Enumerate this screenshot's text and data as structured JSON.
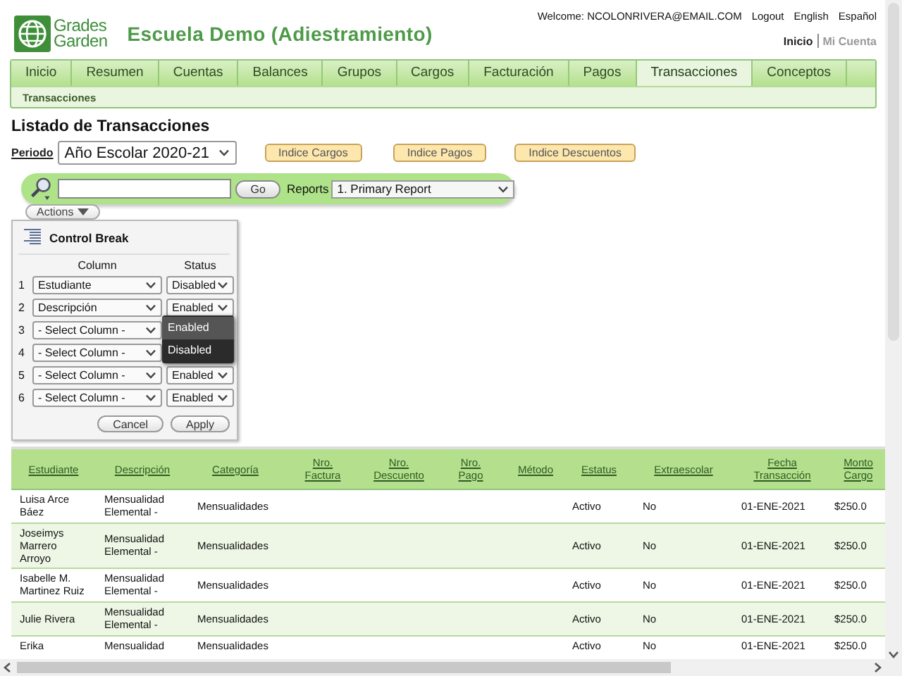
{
  "header": {
    "logo_words": [
      "Grades",
      "Garden"
    ],
    "school_title": "Escuela Demo (Adiestramiento)",
    "welcome": "Welcome: NCOLONRIVERA@EMAIL.COM",
    "user_links": [
      "Logout",
      "English",
      "Español"
    ],
    "account_links": [
      {
        "label": "Inicio",
        "selected": true
      },
      {
        "label": "Mi Cuenta",
        "selected": false
      }
    ]
  },
  "nav": {
    "tabs": [
      {
        "label": "Inicio",
        "selected": false
      },
      {
        "label": "Resumen",
        "selected": false
      },
      {
        "label": "Cuentas",
        "selected": false
      },
      {
        "label": "Balances",
        "selected": false
      },
      {
        "label": "Grupos",
        "selected": false
      },
      {
        "label": "Cargos",
        "selected": false
      },
      {
        "label": "Facturación",
        "selected": false
      },
      {
        "label": "Pagos",
        "selected": false
      },
      {
        "label": "Transacciones",
        "selected": true
      },
      {
        "label": "Conceptos",
        "selected": false
      }
    ],
    "subtabs": [
      "Transacciones"
    ]
  },
  "page_title": "Listado de Transacciones",
  "period": {
    "label": "Periodo",
    "value": "Año Escolar 2020-21"
  },
  "index_buttons": [
    "Indice Cargos",
    "Indice Pagos",
    "Indice Descuentos"
  ],
  "search": {
    "go_button": "Go",
    "reports_label": "Reports",
    "report": "1. Primary Report"
  },
  "actions_button": "Actions",
  "control_break": {
    "title": "Control Break",
    "column_header": "Column",
    "status_header": "Status",
    "rows": [
      {
        "number": "1",
        "column": "Estudiante",
        "status": "Disabled"
      },
      {
        "number": "2",
        "column": "Descripción",
        "status": "Enabled"
      },
      {
        "number": "3",
        "column": "- Select Column -"
      },
      {
        "number": "4",
        "column": "- Select Column -"
      },
      {
        "number": "5",
        "column": "- Select Column -",
        "status": "Enabled"
      },
      {
        "number": "6",
        "column": "- Select Column -",
        "status": "Enabled"
      }
    ],
    "status_menu": {
      "options": [
        {
          "label": "Enabled",
          "selected": true
        },
        {
          "label": "Disabled",
          "selected": false
        }
      ]
    },
    "buttons": [
      "Cancel",
      "Apply"
    ]
  },
  "table": {
    "columns": [
      "Estudiante",
      "Descripción",
      "Categoría",
      "Nro.\nFactura",
      "Nro.\nDescuento",
      "Nro.\nPago",
      "Método",
      "Estatus",
      "Extraescolar",
      "Fecha\nTransacción",
      "Monto\nCargo"
    ],
    "rows": [
      [
        "Luisa Arce\nBáez",
        "Mensualidad\nElemental -",
        "Mensualidades",
        "",
        "",
        "",
        "",
        "Activo",
        "No",
        "01-ENE-2021",
        "$250.0"
      ],
      [
        "Joseimys\nMarrero\nArroyo",
        "Mensualidad\nElemental -",
        "Mensualidades",
        "",
        "",
        "",
        "",
        "Activo",
        "No",
        "01-ENE-2021",
        "$250.0"
      ],
      [
        "Isabelle M.\nMartinez Ruiz",
        "Mensualidad\nElemental -",
        "Mensualidades",
        "",
        "",
        "",
        "",
        "Activo",
        "No",
        "01-ENE-2021",
        "$250.0"
      ],
      [
        "Julie Rivera",
        "Mensualidad\nElemental -",
        "Mensualidades",
        "",
        "",
        "",
        "",
        "Activo",
        "No",
        "01-ENE-2021",
        "$250.0"
      ],
      [
        "Erika",
        "Mensualidad",
        "Mensualidades",
        "",
        "",
        "",
        "",
        "Activo",
        "No",
        "01-ENE-2021",
        "$250.0"
      ]
    ]
  }
}
